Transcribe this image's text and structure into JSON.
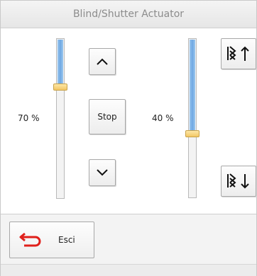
{
  "window": {
    "title": "Blind/Shutter Actuator"
  },
  "left_slider": {
    "value_label": "70 %",
    "level": 0.7
  },
  "right_slider": {
    "value_label": "40 %",
    "level": 0.4
  },
  "buttons": {
    "up_icon": "chevron-up-icon",
    "stop_label": "Stop",
    "down_icon": "chevron-down-icon",
    "slats_up_icon": "slats-up-arrow-icon",
    "slats_down_icon": "slats-down-arrow-icon"
  },
  "footer": {
    "exit_label": "Esci",
    "exit_icon": "return-arrow-icon"
  },
  "colors": {
    "slider_fill": "#6fa8e2",
    "thumb": "#f3c765",
    "exit_icon": "#e0201b"
  }
}
